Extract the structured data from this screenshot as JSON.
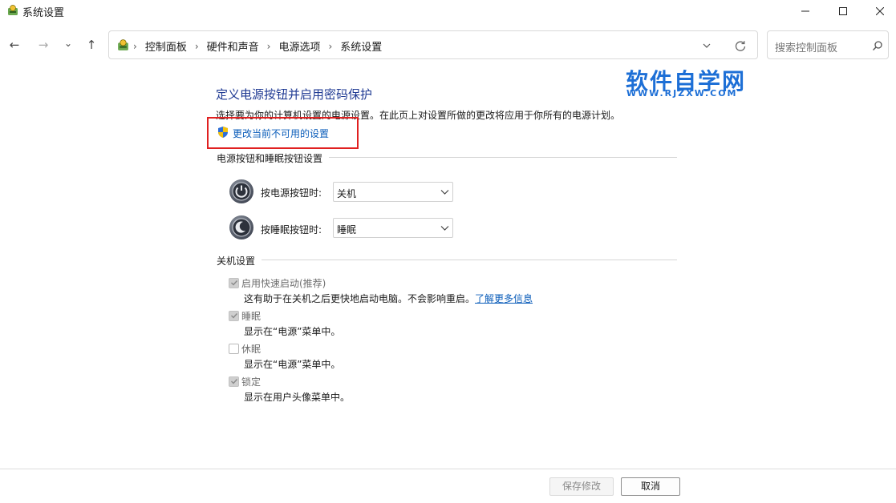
{
  "window": {
    "title": "系统设置"
  },
  "nav": {
    "back": "←",
    "forward": "→",
    "recent": "⌄",
    "up": "↑"
  },
  "breadcrumb": [
    "控制面板",
    "硬件和声音",
    "电源选项",
    "系统设置"
  ],
  "breadcrumb_separator": "›",
  "search": {
    "placeholder": "搜索控制面板"
  },
  "watermark": {
    "title": "软件自学网",
    "url": "WWW.RJZXW.COM"
  },
  "main": {
    "heading": "定义电源按钮并启用密码保护",
    "description": "选择要为你的计算机设置的电源设置。在此页上对设置所做的更改将应用于你所有的电源计划。",
    "change_link": "更改当前不可用的设置",
    "power_section": {
      "title": "电源按钮和睡眠按钮设置",
      "power_button_label": "按电源按钮时:",
      "power_button_value": "关机",
      "sleep_button_label": "按睡眠按钮时:",
      "sleep_button_value": "睡眠"
    },
    "shutdown_section": {
      "title": "关机设置",
      "items": [
        {
          "label": "启用快速启动(推荐)",
          "checked": true,
          "desc": "这有助于在关机之后更快地启动电脑。不会影响重启。",
          "link": "了解更多信息"
        },
        {
          "label": "睡眠",
          "checked": true,
          "desc": "显示在“电源”菜单中。"
        },
        {
          "label": "休眠",
          "checked": false,
          "desc": "显示在“电源”菜单中。"
        },
        {
          "label": "锁定",
          "checked": true,
          "desc": "显示在用户头像菜单中。"
        }
      ]
    }
  },
  "footer": {
    "save": "保存修改",
    "cancel": "取消"
  },
  "colors": {
    "heading": "#1f3a93",
    "link": "#0b5dba",
    "highlight_box": "#e02020",
    "watermark": "#1d6fd6"
  }
}
